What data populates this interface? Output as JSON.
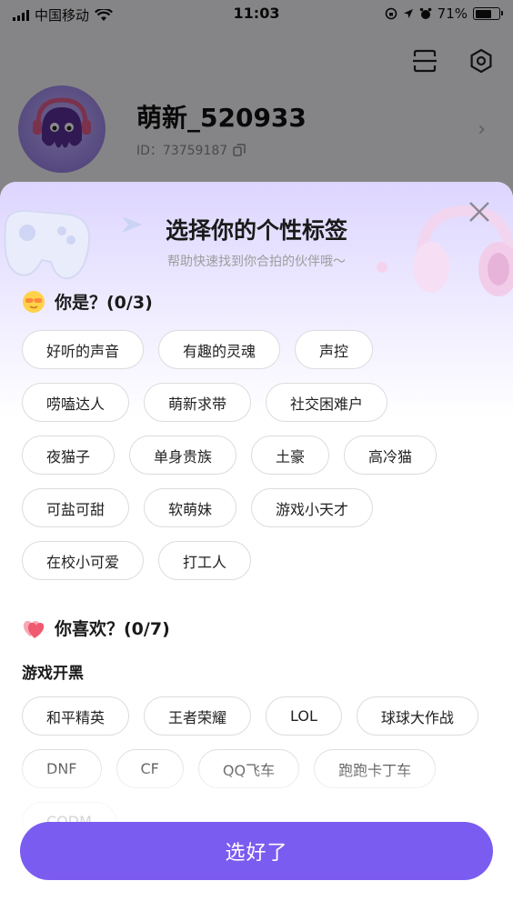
{
  "status_bar": {
    "carrier": "中国移动",
    "time": "11:03",
    "battery": "71%",
    "battery_level": 0.71
  },
  "profile": {
    "name": "萌新_520933",
    "id_text": "ID：73759187"
  },
  "modal": {
    "title": "选择你的个性标签",
    "subtitle": "帮助快速找到你合拍的伙伴哦～",
    "section1": {
      "title": "你是？(0/3)",
      "tags": [
        "好听的声音",
        "有趣的灵魂",
        "声控",
        "唠嗑达人",
        "萌新求带",
        "社交困难户",
        "夜猫子",
        "单身贵族",
        "土豪",
        "高冷猫",
        "可盐可甜",
        "软萌妹",
        "游戏小天才",
        "在校小可爱",
        "打工人"
      ]
    },
    "section2": {
      "title": "你喜欢？(0/7)",
      "subsection": "游戏开黑",
      "tags": [
        "和平精英",
        "王者荣耀",
        "LOL",
        "球球大作战",
        "DNF",
        "CF",
        "QQ飞车",
        "跑跑卡丁车",
        "CODM"
      ]
    },
    "confirm_label": "选好了"
  },
  "colors": {
    "accent": "#7b5cf0",
    "header_gradient": "#ddd5ff"
  }
}
